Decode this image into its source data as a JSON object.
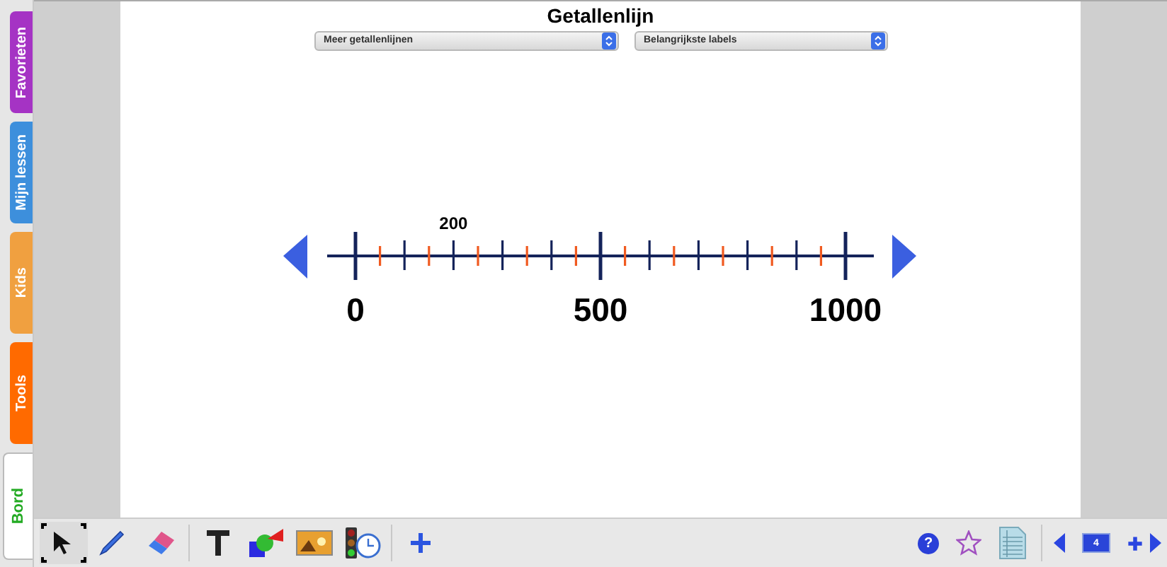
{
  "side_tabs": [
    {
      "label": "Favorieten",
      "color": "#a533c4",
      "selected": false
    },
    {
      "label": "Mijn lessen",
      "color": "#3d8fdc",
      "selected": false
    },
    {
      "label": "Kids",
      "color": "#f0a040",
      "selected": false
    },
    {
      "label": "Tools",
      "color": "#ff6a00",
      "selected": false
    },
    {
      "label": "Bord",
      "color": "#ffffff",
      "selected": true
    }
  ],
  "title": "Getallenlijn",
  "dropdowns": [
    {
      "value": "Meer getallenlijnen"
    },
    {
      "value": "Belangrijkste labels"
    }
  ],
  "number_line": {
    "major_labels": [
      "0",
      "500",
      "1000"
    ],
    "marker_label": "200"
  },
  "tools": [
    {
      "kind": "select",
      "selected": true
    },
    {
      "kind": "pen",
      "selected": false
    },
    {
      "kind": "eraser",
      "selected": false
    },
    {
      "kind": "text",
      "selected": false
    },
    {
      "kind": "shapes",
      "selected": false
    },
    {
      "kind": "picture",
      "selected": false
    },
    {
      "kind": "timer",
      "selected": false
    },
    {
      "kind": "add",
      "selected": false
    }
  ],
  "help_button": "?",
  "page_number": "4"
}
